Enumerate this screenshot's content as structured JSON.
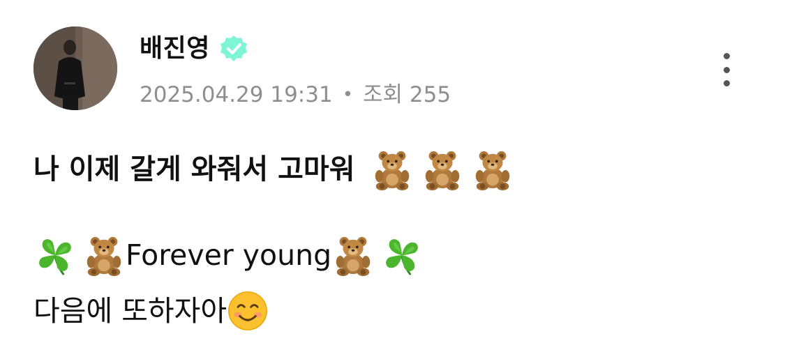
{
  "author": {
    "name": "배진영",
    "verified": true,
    "verified_color": "#7ff5d8",
    "avatar_icon": "profile-photo"
  },
  "meta": {
    "timestamp": "2025.04.29 19:31",
    "separator": "•",
    "views_label": "조회 255"
  },
  "menu": {
    "icon": "more-vertical-icon"
  },
  "post": {
    "title": "나 이제 갈게 와줘서 고마워",
    "title_emojis": [
      "teddy-bear",
      "teddy-bear",
      "teddy-bear"
    ],
    "line1_text": "Forever young",
    "line1_emojis_before": [
      "four-leaf-clover",
      "teddy-bear"
    ],
    "line1_emojis_after": [
      "teddy-bear",
      "four-leaf-clover"
    ],
    "line2_text": "다음에 또하자아",
    "line2_emoji": "smiling-face"
  },
  "colors": {
    "text": "#111111",
    "meta": "#8e8e8e",
    "more_dots": "#555555"
  }
}
